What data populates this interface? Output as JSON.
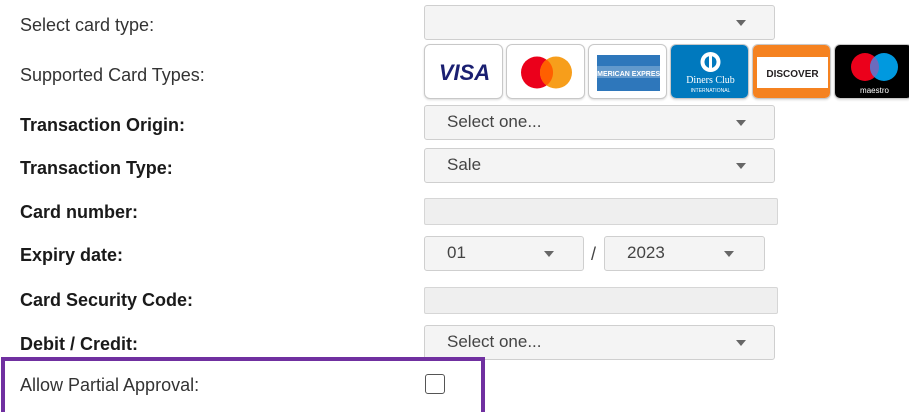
{
  "fields": {
    "card_type": {
      "label": "Select card type:",
      "value": ""
    },
    "supported": {
      "label": "Supported Card Types:"
    },
    "origin": {
      "label": "Transaction Origin:",
      "value": "Select one..."
    },
    "type": {
      "label": "Transaction Type:",
      "value": "Sale"
    },
    "card_number": {
      "label": "Card number:",
      "value": ""
    },
    "expiry": {
      "label": "Expiry date:",
      "month": "01",
      "separator": "/",
      "year": "2023"
    },
    "csc": {
      "label": "Card Security Code:",
      "value": ""
    },
    "debit_credit": {
      "label": "Debit / Credit:",
      "value": "Select one..."
    },
    "partial": {
      "label": "Allow Partial Approval:",
      "checked": false
    }
  },
  "cards": [
    {
      "name": "visa-logo",
      "text": "VISA"
    },
    {
      "name": "mastercard-logo",
      "text": ""
    },
    {
      "name": "amex-logo",
      "text": "AMERICAN EXPRESS"
    },
    {
      "name": "diners-club-logo",
      "text": "Diners Club",
      "subtext": "INTERNATIONAL"
    },
    {
      "name": "discover-logo",
      "text": "DISCOVER"
    },
    {
      "name": "maestro-logo",
      "text": "maestro"
    }
  ],
  "colors": {
    "highlight": "#7030a0",
    "visa": "#1a1f71",
    "mastercard_red": "#eb001b",
    "mastercard_orange": "#f79e1b",
    "amex": "#2e77bb",
    "diners": "#0079be",
    "discover_orange": "#f58220",
    "maestro_blue": "#0099df"
  }
}
